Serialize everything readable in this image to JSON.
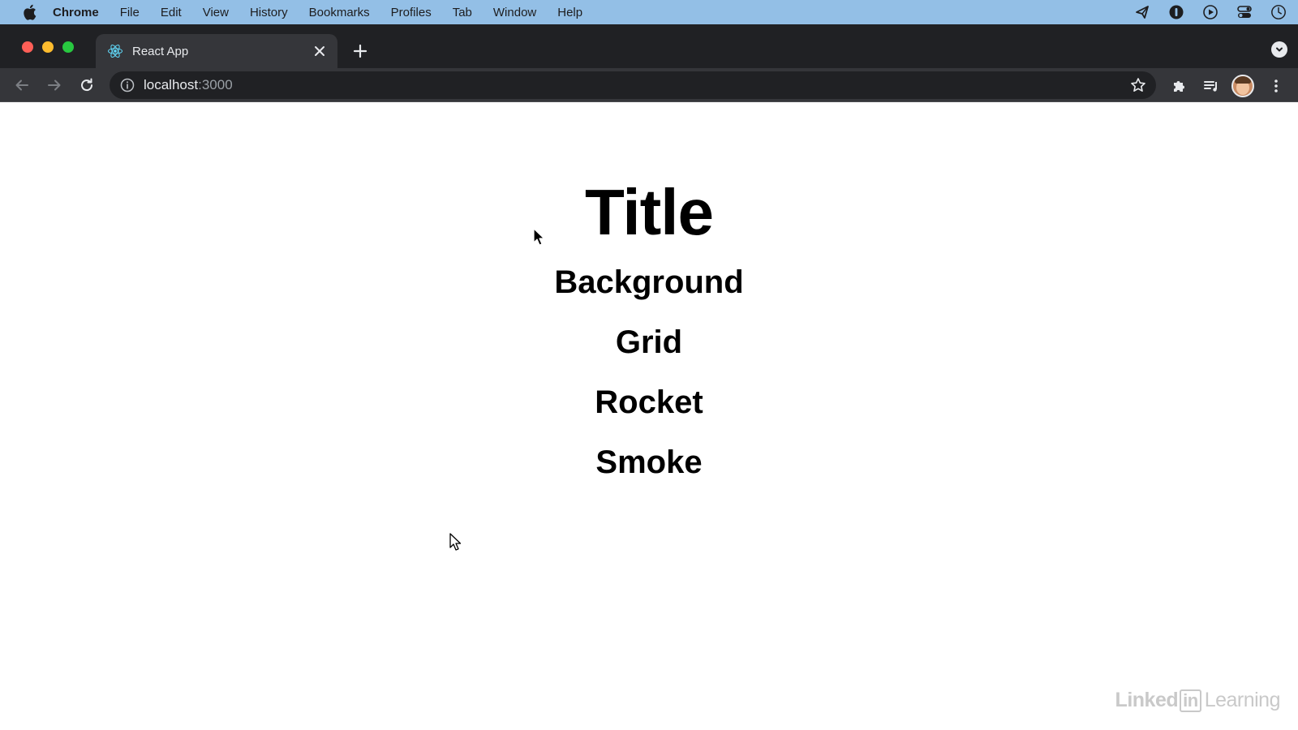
{
  "menubar": {
    "app_name": "Chrome",
    "items": [
      "File",
      "Edit",
      "View",
      "History",
      "Bookmarks",
      "Profiles",
      "Tab",
      "Window",
      "Help"
    ],
    "status_icons": [
      "send-icon",
      "password-manager-icon",
      "play-circle-icon",
      "control-center-icon",
      "clock-icon"
    ]
  },
  "browser": {
    "tab": {
      "title": "React App",
      "favicon": "react-logo-icon"
    },
    "address": {
      "host": "localhost",
      "port": ":3000"
    }
  },
  "page": {
    "title": "Title",
    "links": [
      "Background",
      "Grid",
      "Rocket",
      "Smoke"
    ]
  },
  "watermark": {
    "linked": "Linked",
    "in": "in",
    "learning": "Learning"
  },
  "colors": {
    "menubar": "#93bfe6",
    "chrome_dark": "#202124",
    "chrome_toolbar": "#35363a",
    "traffic_red": "#ff5f57",
    "traffic_yellow": "#febc2e",
    "traffic_green": "#28c840",
    "react_blue": "#61dafb"
  }
}
